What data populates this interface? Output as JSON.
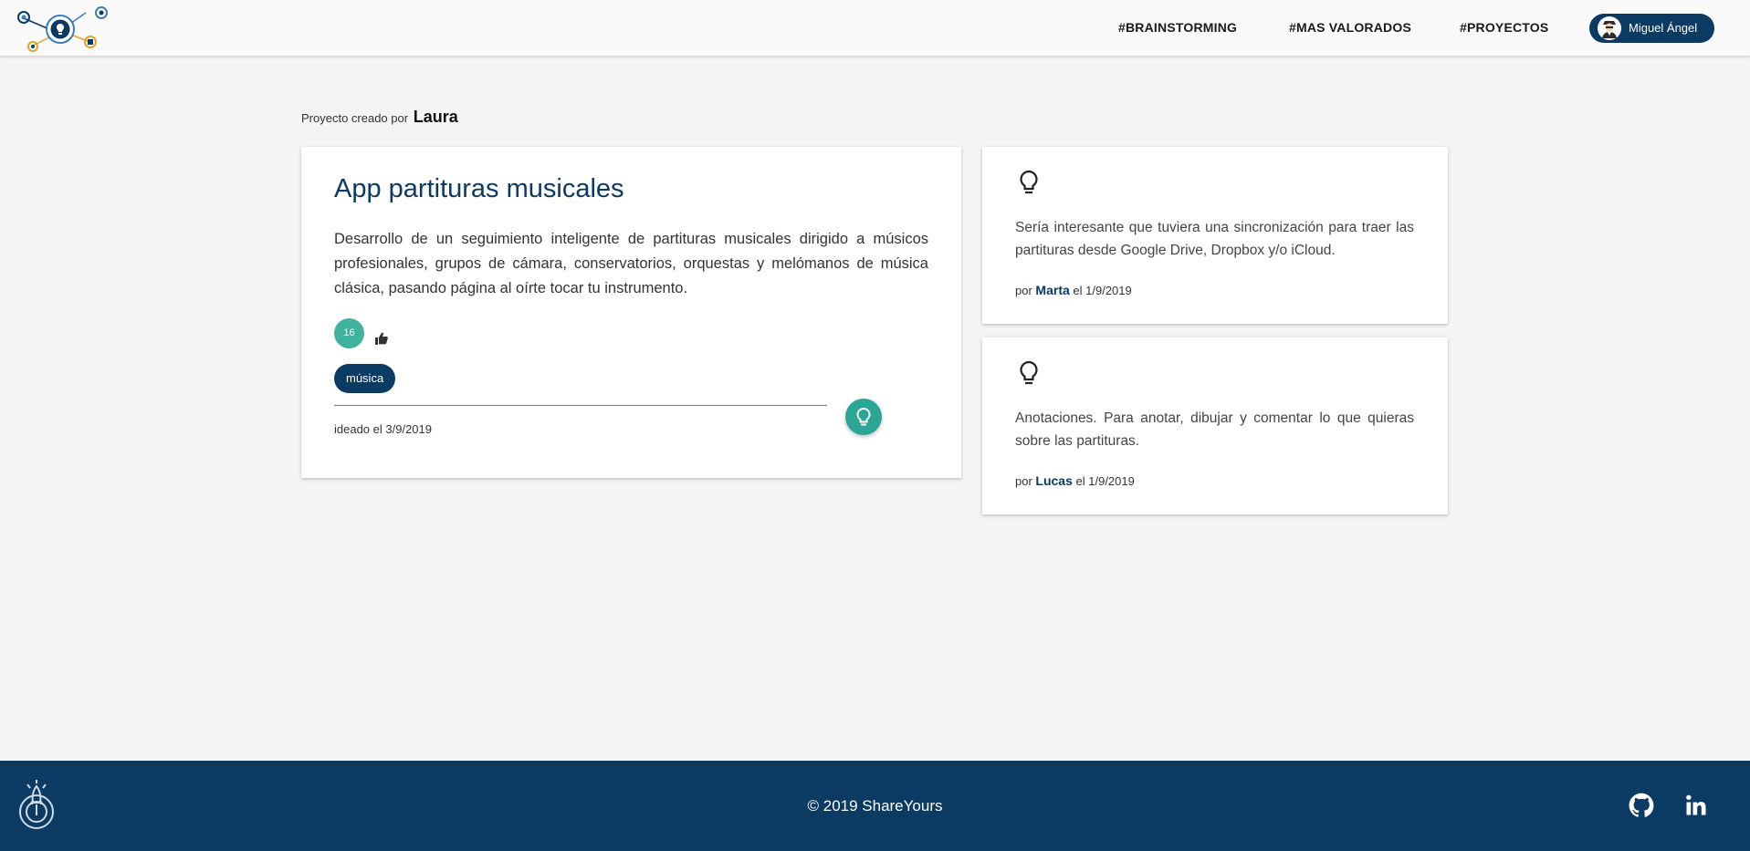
{
  "header": {
    "nav": [
      {
        "label": "#BRAINSTORMING"
      },
      {
        "label": "#MAS VALORADOS"
      },
      {
        "label": "#PROYECTOS"
      }
    ],
    "user": {
      "name": "Miguel Ángel",
      "avatar_icon": "user-avatar-icon"
    },
    "logo_icon": "lightbulb-network-logo"
  },
  "project": {
    "created_by_prefix": "Proyecto creado por",
    "author": "Laura",
    "title": "App partituras musicales",
    "description": "Desarrollo de un seguimiento inteligente de partituras musicales dirigido a músicos profesionales, grupos de cámara, conservatorios, orquestas y melómanos de música clásica, pasando página al oírte tocar tu instrumento.",
    "votes": "16",
    "tag": "música",
    "date_label": "ideado el 3/9/2019",
    "fab_icon": "lightbulb-icon"
  },
  "comments": [
    {
      "text": "Sería interesante que tuviera una sincronización para traer las partituras desde Google Drive, Dropbox y/o iCloud.",
      "by_prefix": "por",
      "author": "Marta",
      "date": "el 1/9/2019"
    },
    {
      "text": "Anotaciones. Para anotar, dibujar y comentar lo que quieras sobre las partituras.",
      "by_prefix": "por",
      "author": "Lucas",
      "date": "el 1/9/2019"
    }
  ],
  "footer": {
    "copyright": "© 2019 ShareYours",
    "social": [
      "github-icon",
      "linkedin-icon"
    ]
  },
  "colors": {
    "primary": "#0b3a63",
    "accent": "#2aa596",
    "votes": "#3fb39d",
    "background": "#f4f4f4"
  }
}
